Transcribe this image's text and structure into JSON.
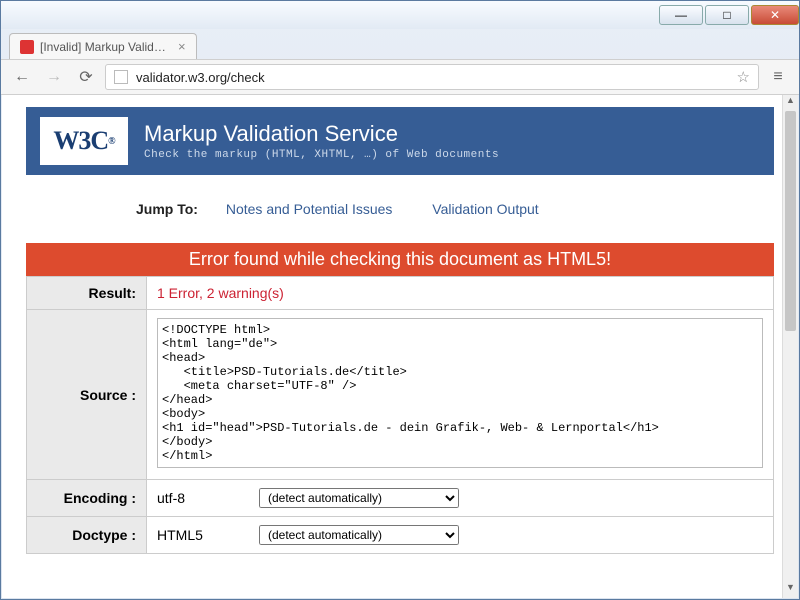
{
  "browser": {
    "tab_title": "[Invalid] Markup Validatio",
    "url": "validator.w3.org/check"
  },
  "header": {
    "logo_text": "W3C",
    "title": "Markup Validation Service",
    "tagline": "Check the markup (HTML, XHTML, …) of Web documents"
  },
  "jump": {
    "label": "Jump To:",
    "links": [
      "Notes and Potential Issues",
      "Validation Output"
    ]
  },
  "error_banner": "Error found while checking this document as HTML5!",
  "results": {
    "result_label": "Result:",
    "result_value": "1 Error, 2 warning(s)",
    "source_label": "Source :",
    "source_value": "<!DOCTYPE html>\n<html lang=\"de\">\n<head>\n   <title>PSD-Tutorials.de</title>\n   <meta charset=\"UTF-8\" />\n</head>\n<body>\n<h1 id=\"head\">PSD-Tutorials.de - dein Grafik-, Web- & Lernportal</h1>\n</body>\n</html>",
    "encoding_label": "Encoding :",
    "encoding_value": "utf-8",
    "encoding_select": "(detect automatically)",
    "doctype_label": "Doctype :",
    "doctype_value": "HTML5",
    "doctype_select": "(detect automatically)"
  }
}
